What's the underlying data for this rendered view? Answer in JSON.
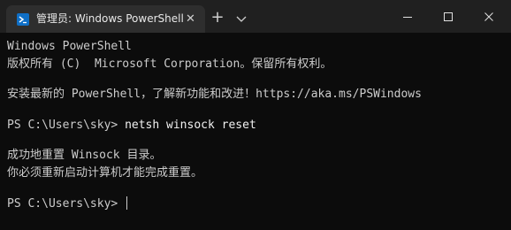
{
  "tab": {
    "title": "管理员: Windows PowerShell",
    "icon": "powershell-icon",
    "close_icon": "close-icon"
  },
  "titlebar": {
    "new_tab_label": "+",
    "dropdown_icon": "chevron-down-icon",
    "minimize_icon": "minimize-icon",
    "maximize_icon": "maximize-icon",
    "close_icon": "close-icon"
  },
  "terminal": {
    "lines": [
      "Windows PowerShell",
      "版权所有 (C)  Microsoft Corporation。保留所有权利。",
      "安装最新的 PowerShell，了解新功能和改进！https://aka.ms/PSWindows",
      "PS C:\\Users\\sky> ",
      "netsh winsock reset",
      "成功地重置 Winsock 目录。",
      "你必须重新启动计算机才能完成重置。",
      "PS C:\\Users\\sky> "
    ]
  },
  "colors": {
    "background": "#0c0c0c",
    "titlebar": "#202020",
    "active_tab": "#2e2e2e",
    "text": "#cccccc"
  }
}
